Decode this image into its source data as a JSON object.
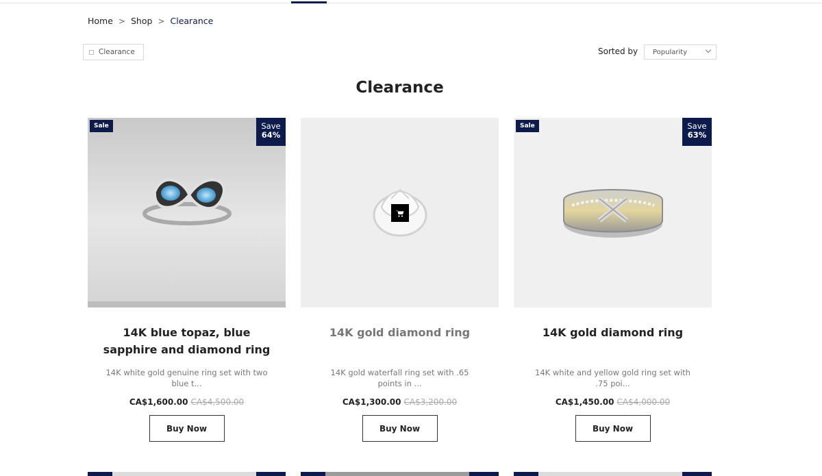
{
  "breadcrumb": {
    "home": "Home",
    "shop": "Shop",
    "current": "Clearance",
    "separator": ">"
  },
  "filter": {
    "label": "Clearance"
  },
  "sort": {
    "label": "Sorted by",
    "selected": "Popularity"
  },
  "page_title": "Clearance",
  "colors": {
    "accent": "#0d1b4c",
    "text": "#222222",
    "muted": "#777777"
  },
  "products": [
    {
      "name": "14K blue topaz, blue sapphire and diamond ring",
      "description": "14K white gold genuine ring set with two blue t...",
      "price": "CA$1,600.00",
      "old_price": "CA$4,500.00",
      "sale_badge": "Sale",
      "save_label": "Save",
      "save_pct": "64%",
      "buy_label": "Buy Now"
    },
    {
      "name": "14K gold diamond ring",
      "description": "14K gold waterfall ring set with .65 points in ...",
      "price": "CA$1,300.00",
      "old_price": "CA$3,200.00",
      "buy_label": "Buy Now",
      "cart_icon": "cart-icon"
    },
    {
      "name": "14K gold diamond ring",
      "description": "14K white and yellow gold ring set with .75 poi...",
      "price": "CA$1,450.00",
      "old_price": "CA$4,000.00",
      "sale_badge": "Sale",
      "save_label": "Save",
      "save_pct": "63%",
      "buy_label": "Buy Now"
    }
  ]
}
